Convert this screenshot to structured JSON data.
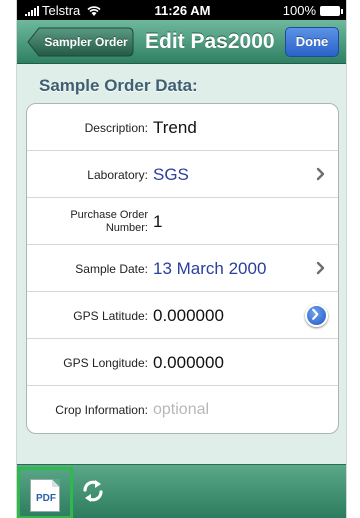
{
  "status_bar": {
    "carrier": "Telstra",
    "time": "11:26 AM",
    "battery": "100%"
  },
  "nav": {
    "back_label": "Sampler Order",
    "title": "Edit Pas2000",
    "done_label": "Done"
  },
  "section": {
    "title": "Sample Order Data:"
  },
  "rows": [
    {
      "label": "Description:",
      "value": "Trend"
    },
    {
      "label": "Laboratory:",
      "value": "SGS"
    },
    {
      "label": "Purchase Order Number:",
      "value": "1"
    },
    {
      "label": "Sample Date:",
      "value": "13 March 2000"
    },
    {
      "label": "GPS Latitude:",
      "value": "0.000000"
    },
    {
      "label": "GPS Longitude:",
      "value": "0.000000"
    },
    {
      "label": "Crop Information:",
      "placeholder": "optional"
    }
  ],
  "toolbar": {
    "pdf_label": "PDF",
    "icons": [
      "pdf-icon",
      "refresh-icon"
    ]
  },
  "colors": {
    "nav_green": "#2f8063",
    "done_blue": "#2b62c9",
    "link_blue": "#2a3f9e",
    "highlight_green": "#2fb84b"
  }
}
